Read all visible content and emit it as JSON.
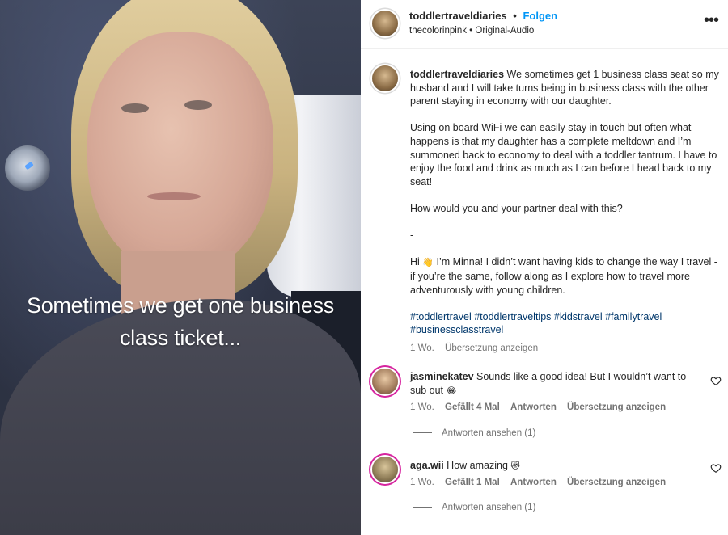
{
  "video": {
    "caption_line1": "Sometimes we get one business",
    "caption_line2": "class ticket..."
  },
  "header": {
    "username": "toddlertraveldiaries",
    "separator": "•",
    "follow_label": "Folgen",
    "audio_user": "thecolorinpink",
    "audio_separator": "•",
    "audio_label": "Original-Audio",
    "more_icon": "more-horizontal-icon"
  },
  "post": {
    "username": "toddlertraveldiaries",
    "paragraph1": "We sometimes get 1 business class seat so my husband and I will take turns being in business class with the other parent staying in economy with our daughter.",
    "paragraph2": "Using on board WiFi we can easily stay in touch but often what happens is that my daughter has a complete meltdown and I’m summoned back to economy to deal with a toddler tantrum. I have to enjoy the food and drink as much as I can before I head back to my seat!",
    "paragraph3": "How would you and your partner deal with this?",
    "paragraph4": "-",
    "paragraph5_a": "Hi",
    "paragraph5_emoji": "👋",
    "paragraph5_b": "I’m Minna! I didn’t want having kids to change the way I travel - if you’re the same, follow along as I explore how to travel more adventurously with young children.",
    "hashtags": "#toddlertravel #toddlertraveltips #kidstravel #familytravel #businessclasstravel",
    "time": "1 Wo.",
    "translate": "Übersetzung anzeigen"
  },
  "comments": [
    {
      "username": "jasminekatev",
      "text": "Sounds like a good idea! But I wouldn’t want to sub out",
      "emoji": "😂",
      "time": "1 Wo.",
      "likes": "Gefällt 4 Mal",
      "reply": "Antworten",
      "translate": "Übersetzung anzeigen",
      "view_replies": "Antworten ansehen (1)"
    },
    {
      "username": "aga.wii",
      "text": "How amazing",
      "emoji": "😻",
      "time": "1 Wo.",
      "likes": "Gefällt 1 Mal",
      "reply": "Antworten",
      "translate": "Übersetzung anzeigen",
      "view_replies": "Antworten ansehen (1)"
    }
  ],
  "colors": {
    "link_blue": "#0095f6",
    "hashtag_blue": "#00376b",
    "meta_gray": "#737373",
    "story_ring": "#d6249f"
  }
}
